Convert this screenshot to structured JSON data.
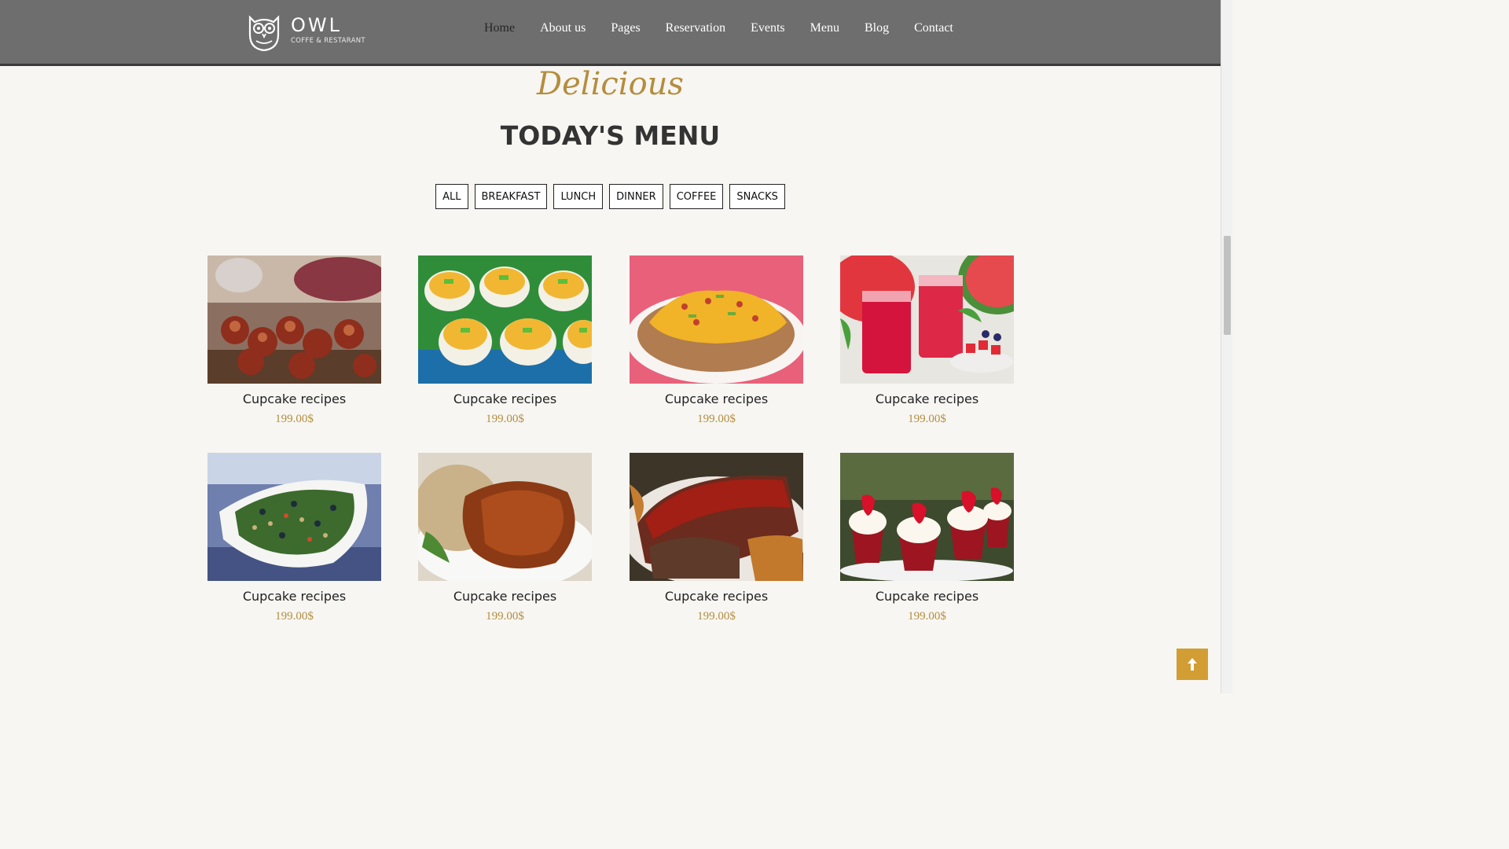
{
  "header": {
    "logo_name": "OWL",
    "logo_tagline": "COFFE & RESTARANT",
    "nav": [
      {
        "label": "Home"
      },
      {
        "label": "About us"
      },
      {
        "label": "Pages"
      },
      {
        "label": "Reservation"
      },
      {
        "label": "Events"
      },
      {
        "label": "Menu"
      },
      {
        "label": "Blog"
      },
      {
        "label": "Contact"
      }
    ],
    "active_nav": "Home"
  },
  "section": {
    "script_title": "Delicious",
    "title": "TODAY'S MENU"
  },
  "filters": [
    "ALL",
    "BREAKFAST",
    "LUNCH",
    "DINNER",
    "COFFEE",
    "SNACKS"
  ],
  "items": [
    {
      "name": "Cupcake recipes",
      "price": "199.00$",
      "image": "bacon-wrapped-bites"
    },
    {
      "name": "Cupcake recipes",
      "price": "199.00$",
      "image": "deviled-eggs"
    },
    {
      "name": "Cupcake recipes",
      "price": "199.00$",
      "image": "cheesy-baked-potato"
    },
    {
      "name": "Cupcake recipes",
      "price": "199.00$",
      "image": "watermelon-drinks"
    },
    {
      "name": "Cupcake recipes",
      "price": "199.00$",
      "image": "quinoa-salad"
    },
    {
      "name": "Cupcake recipes",
      "price": "199.00$",
      "image": "glazed-pork-chop"
    },
    {
      "name": "Cupcake recipes",
      "price": "199.00$",
      "image": "meatloaf"
    },
    {
      "name": "Cupcake recipes",
      "price": "199.00$",
      "image": "strawberry-cupcakes"
    }
  ],
  "colors": {
    "header_bg": "#6e6e6e",
    "accent": "#b48d3e",
    "to_top_bg": "#d29d32",
    "page_bg": "#f7f6f2"
  },
  "icons": {
    "logo": "owl-icon",
    "to_top": "arrow-up-icon"
  }
}
